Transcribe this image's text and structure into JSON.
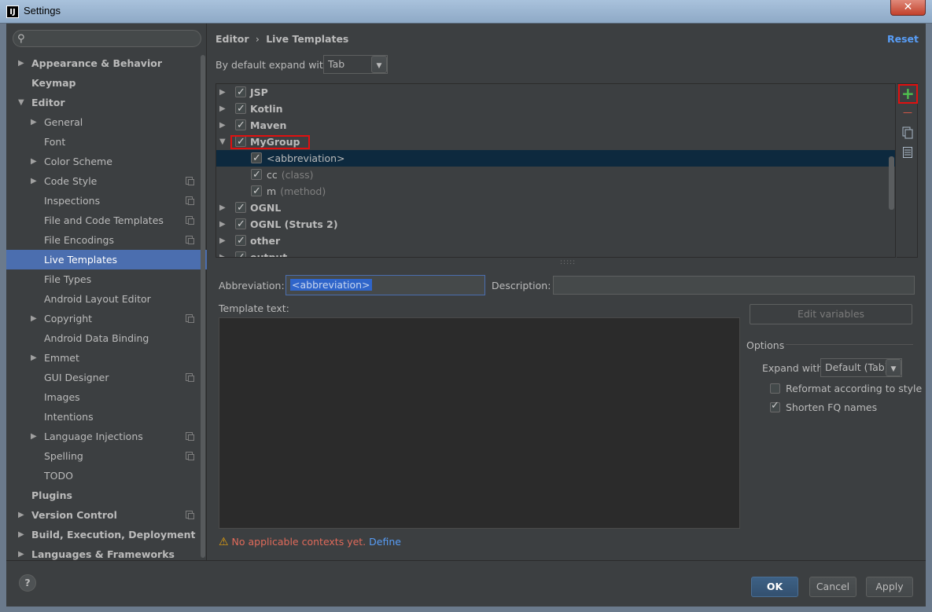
{
  "window": {
    "title": "Settings",
    "app_icon": "IJ",
    "close_symbol": "✕"
  },
  "search": {
    "placeholder": "",
    "icon": "search-icon"
  },
  "sidebar": {
    "items": [
      {
        "label": "Appearance & Behavior",
        "arrow": "▶",
        "bold": true
      },
      {
        "label": "Keymap",
        "arrow": "",
        "bold": true
      },
      {
        "label": "Editor",
        "arrow": "▼",
        "bold": true
      },
      {
        "label": "General",
        "arrow": "▶"
      },
      {
        "label": "Font",
        "arrow": ""
      },
      {
        "label": "Color Scheme",
        "arrow": "▶"
      },
      {
        "label": "Code Style",
        "arrow": "▶",
        "project": true
      },
      {
        "label": "Inspections",
        "arrow": "",
        "project": true
      },
      {
        "label": "File and Code Templates",
        "arrow": "",
        "project": true
      },
      {
        "label": "File Encodings",
        "arrow": "",
        "project": true
      },
      {
        "label": "Live Templates",
        "arrow": "",
        "selected": true
      },
      {
        "label": "File Types",
        "arrow": ""
      },
      {
        "label": "Android Layout Editor",
        "arrow": ""
      },
      {
        "label": "Copyright",
        "arrow": "▶",
        "project": true
      },
      {
        "label": "Android Data Binding",
        "arrow": ""
      },
      {
        "label": "Emmet",
        "arrow": "▶"
      },
      {
        "label": "GUI Designer",
        "arrow": "",
        "project": true
      },
      {
        "label": "Images",
        "arrow": ""
      },
      {
        "label": "Intentions",
        "arrow": ""
      },
      {
        "label": "Language Injections",
        "arrow": "▶",
        "project": true
      },
      {
        "label": "Spelling",
        "arrow": "",
        "project": true
      },
      {
        "label": "TODO",
        "arrow": ""
      },
      {
        "label": "Plugins",
        "arrow": "",
        "bold": true
      },
      {
        "label": "Version Control",
        "arrow": "▶",
        "bold": true,
        "project": true
      },
      {
        "label": "Build, Execution, Deployment",
        "arrow": "▶",
        "bold": true
      },
      {
        "label": "Languages & Frameworks",
        "arrow": "▶",
        "bold": true
      }
    ]
  },
  "header": {
    "breadcrumb_parent": "Editor",
    "breadcrumb_sep": "›",
    "breadcrumb_current": "Live Templates",
    "reset_label": "Reset"
  },
  "expand": {
    "label": "By default expand with",
    "value": "Tab",
    "arrow": "▼"
  },
  "templates": [
    {
      "name": "JSP",
      "arrow": "▶",
      "checked": true,
      "level": 0
    },
    {
      "name": "Kotlin",
      "arrow": "▶",
      "checked": true,
      "level": 0
    },
    {
      "name": "Maven",
      "arrow": "▶",
      "checked": true,
      "level": 0
    },
    {
      "name": "MyGroup",
      "arrow": "▼",
      "checked": true,
      "level": 0,
      "highlight": true
    },
    {
      "name": "<abbreviation>",
      "desc": "",
      "checked": true,
      "level": 1,
      "selected": true
    },
    {
      "name": "cc",
      "desc": "(class)",
      "checked": true,
      "level": 1
    },
    {
      "name": "m",
      "desc": "(method)",
      "checked": true,
      "level": 1
    },
    {
      "name": "OGNL",
      "arrow": "▶",
      "checked": true,
      "level": 0
    },
    {
      "name": "OGNL (Struts 2)",
      "arrow": "▶",
      "checked": true,
      "level": 0
    },
    {
      "name": "other",
      "arrow": "▶",
      "checked": true,
      "level": 0
    },
    {
      "name": "output",
      "arrow": "▶",
      "checked": true,
      "level": 0
    }
  ],
  "toolbar": {
    "add": "+",
    "remove": "—",
    "copy": "copy-icon",
    "template": "template-icon"
  },
  "editor": {
    "abbreviation_label": "Abbreviation:",
    "abbreviation_value": "<abbreviation>",
    "description_label": "Description:",
    "description_value": "",
    "template_text_label": "Template text:",
    "edit_variables_label": "Edit variables",
    "options_label": "Options",
    "expand_with_label": "Expand with",
    "expand_with_value": "Default (Tab)",
    "reformat_label": "Reformat according to style",
    "reformat_checked": false,
    "shorten_label": "Shorten FQ names",
    "shorten_checked": true
  },
  "warning": {
    "message": "No applicable contexts yet.",
    "link": "Define"
  },
  "buttons": {
    "help": "?",
    "ok": "OK",
    "cancel": "Cancel",
    "apply": "Apply"
  },
  "colors": {
    "accent": "#4b6eaf",
    "background": "#3c3f41",
    "link": "#589df6",
    "add_green": "#4fc14f",
    "remove_red": "#e05a4a"
  }
}
